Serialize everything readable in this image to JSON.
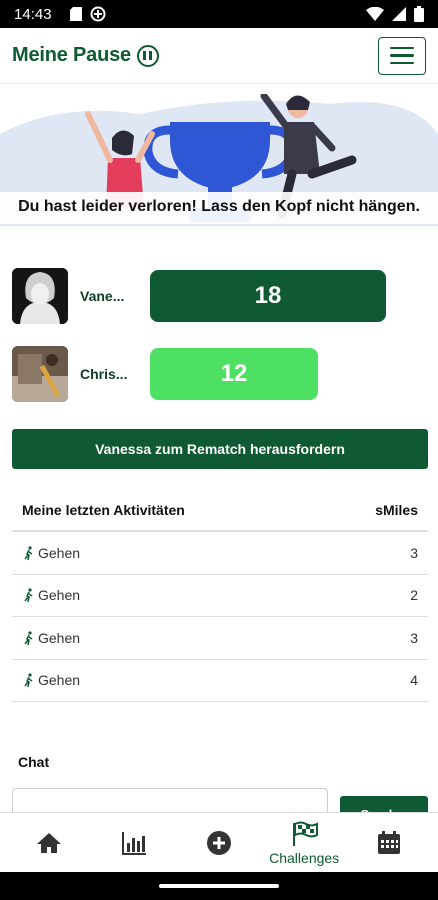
{
  "status_bar": {
    "time": "14:43"
  },
  "header": {
    "brand": "Meine Pause"
  },
  "result": {
    "message": "Du hast leider verloren! Lass den Kopf nicht hängen."
  },
  "players": [
    {
      "name": "Vanessa",
      "display_name": "Vane...",
      "score": "18"
    },
    {
      "name": "Christian",
      "display_name": "Chris...",
      "score": "12"
    }
  ],
  "rematch": {
    "label": "Vanessa zum Rematch herausfordern"
  },
  "activities": {
    "title": "Meine letzten Aktivitäten",
    "unit_header": "sMiles",
    "rows": [
      {
        "label": "Gehen",
        "value": "3"
      },
      {
        "label": "Gehen",
        "value": "2"
      },
      {
        "label": "Gehen",
        "value": "3"
      },
      {
        "label": "Gehen",
        "value": "4"
      }
    ]
  },
  "chat": {
    "label": "Chat",
    "send_label": "Senden"
  },
  "nav": {
    "items": [
      {
        "icon": "home-icon",
        "label": ""
      },
      {
        "icon": "chart-icon",
        "label": ""
      },
      {
        "icon": "add-circle-icon",
        "label": ""
      },
      {
        "icon": "flag-icon",
        "label": "Challenges"
      },
      {
        "icon": "calendar-icon",
        "label": ""
      }
    ]
  },
  "colors": {
    "primary": "#0f5a32",
    "accent": "#4de062",
    "hero_bg": "#dfe7f5",
    "trophy": "#2f56d4"
  }
}
